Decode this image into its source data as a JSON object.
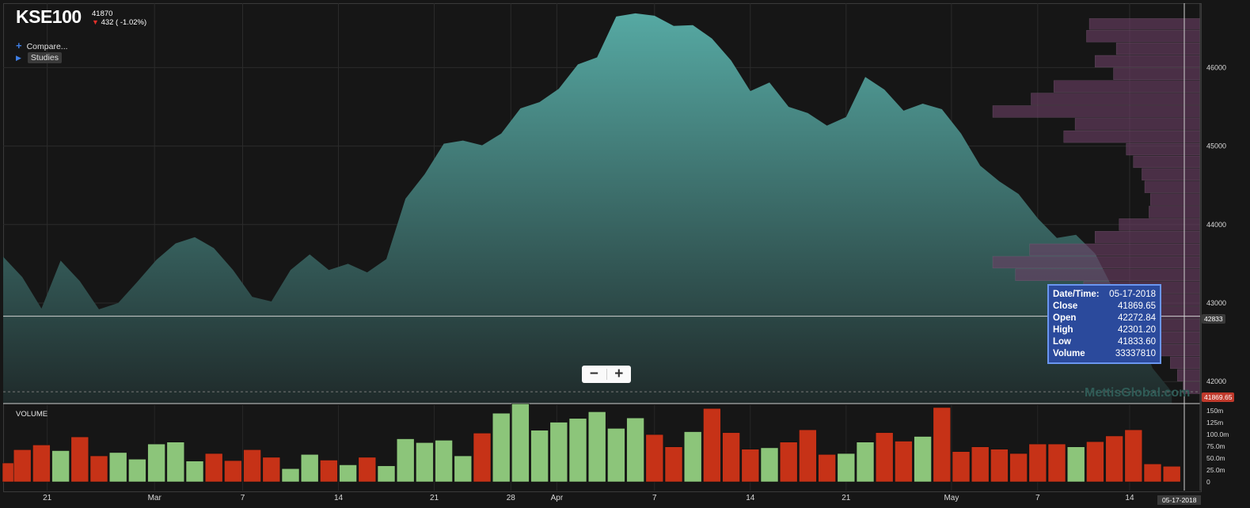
{
  "header": {
    "symbol": "KSE100",
    "last_price": "41870",
    "change": "432 ( -1.02%)"
  },
  "controls": {
    "compare_label": "Compare...",
    "studies_label": "Studies",
    "zoom_out": "−",
    "zoom_in": "+"
  },
  "watermark": "MettisGlobal.com",
  "volume_panel_label": "VOLUME",
  "crosshair": {
    "price_label": "42833",
    "date_label": "05-17-2018"
  },
  "current_close_label": "41869.65",
  "tooltip": {
    "rows": [
      {
        "key": "Date/Time:",
        "value": "05-17-2018"
      },
      {
        "key": "Close",
        "value": "41869.65"
      },
      {
        "key": "Open",
        "value": "42272.84"
      },
      {
        "key": "High",
        "value": "42301.20"
      },
      {
        "key": "Low",
        "value": "41833.60"
      },
      {
        "key": "Volume",
        "value": "33337810"
      }
    ]
  },
  "colors": {
    "area_top": "#56a9a3",
    "area_bottom": "#1f2a2a",
    "volume_up": "#8cc57a",
    "volume_down": "#c63217",
    "profile": "#6b3f64"
  },
  "chart_data": {
    "type": "area",
    "series": [
      {
        "name": "KSE100",
        "values": [
          43590,
          43330,
          42930,
          43540,
          43280,
          42920,
          43000,
          43270,
          43550,
          43760,
          43840,
          43700,
          43420,
          43080,
          43020,
          43420,
          43620,
          43420,
          43500,
          43390,
          43560,
          44330,
          44640,
          45030,
          45070,
          45010,
          45160,
          45480,
          45560,
          45730,
          46040,
          46130,
          46650,
          46690,
          46660,
          46530,
          46540,
          46370,
          46090,
          45700,
          45810,
          45500,
          45420,
          45260,
          45370,
          45880,
          45720,
          45450,
          45540,
          45470,
          45160,
          44750,
          44550,
          44390,
          44080,
          43830,
          43870,
          43630,
          43150,
          42790,
          42170,
          41870
        ]
      }
    ],
    "x_axis_labels": [
      "21",
      "Mar",
      "7",
      "14",
      "21",
      "28",
      "Apr",
      "7",
      "14",
      "21",
      "May",
      "7",
      "14"
    ],
    "y_axis": {
      "ticks": [
        42000,
        43000,
        44000,
        45000,
        46000
      ],
      "range": [
        41720,
        46780
      ]
    },
    "volume": {
      "values": [
        40,
        68,
        78,
        66,
        95,
        55,
        62,
        48,
        80,
        84,
        44,
        60,
        45,
        68,
        52,
        28,
        58,
        46,
        36,
        52,
        34,
        91,
        83,
        88,
        55,
        103,
        145,
        165,
        109,
        126,
        134,
        148,
        113,
        135,
        100,
        74,
        106,
        155,
        104,
        69,
        72,
        84,
        110,
        58,
        60,
        84,
        104,
        86,
        96,
        157,
        64,
        74,
        69,
        60,
        80,
        80,
        74,
        85,
        97,
        110,
        38,
        33
      ],
      "directions": [
        "d",
        "d",
        "d",
        "u",
        "d",
        "d",
        "u",
        "u",
        "u",
        "u",
        "u",
        "d",
        "d",
        "d",
        "d",
        "u",
        "u",
        "d",
        "u",
        "d",
        "u",
        "u",
        "u",
        "u",
        "u",
        "d",
        "u",
        "u",
        "u",
        "u",
        "u",
        "u",
        "u",
        "u",
        "d",
        "d",
        "u",
        "d",
        "d",
        "d",
        "u",
        "d",
        "d",
        "d",
        "u",
        "u",
        "d",
        "d",
        "u",
        "d",
        "d",
        "d",
        "d",
        "d",
        "d",
        "d",
        "u",
        "d",
        "d",
        "d",
        "d",
        "d"
      ],
      "y_ticks": [
        "0",
        "25.0m",
        "50.0m",
        "75.0m",
        "100.0m",
        "125m",
        "150m"
      ],
      "y_max": 162
    },
    "volume_profile": [
      {
        "price_from": 46480,
        "price_to": 46630,
        "size": 0.78
      },
      {
        "price_from": 46320,
        "price_to": 46480,
        "size": 0.8
      },
      {
        "price_from": 46160,
        "price_to": 46320,
        "size": 0.59
      },
      {
        "price_from": 46000,
        "price_to": 46160,
        "size": 0.74
      },
      {
        "price_from": 45840,
        "price_to": 46000,
        "size": 0.61
      },
      {
        "price_from": 45680,
        "price_to": 45840,
        "size": 1.03
      },
      {
        "price_from": 45520,
        "price_to": 45680,
        "size": 1.19
      },
      {
        "price_from": 45360,
        "price_to": 45520,
        "size": 1.46
      },
      {
        "price_from": 45200,
        "price_to": 45360,
        "size": 0.88
      },
      {
        "price_from": 45040,
        "price_to": 45200,
        "size": 0.96
      },
      {
        "price_from": 44880,
        "price_to": 45040,
        "size": 0.52
      },
      {
        "price_from": 44720,
        "price_to": 44880,
        "size": 0.47
      },
      {
        "price_from": 44560,
        "price_to": 44720,
        "size": 0.41
      },
      {
        "price_from": 44400,
        "price_to": 44560,
        "size": 0.39
      },
      {
        "price_from": 44240,
        "price_to": 44400,
        "size": 0.35
      },
      {
        "price_from": 44080,
        "price_to": 44240,
        "size": 0.36
      },
      {
        "price_from": 43920,
        "price_to": 44080,
        "size": 0.57
      },
      {
        "price_from": 43760,
        "price_to": 43920,
        "size": 0.74
      },
      {
        "price_from": 43600,
        "price_to": 43760,
        "size": 1.2
      },
      {
        "price_from": 43440,
        "price_to": 43600,
        "size": 1.46
      },
      {
        "price_from": 43280,
        "price_to": 43440,
        "size": 1.3
      },
      {
        "price_from": 43120,
        "price_to": 43280,
        "size": 0.82
      },
      {
        "price_from": 42960,
        "price_to": 43120,
        "size": 0.84
      },
      {
        "price_from": 42800,
        "price_to": 42960,
        "size": 0.61
      },
      {
        "price_from": 42640,
        "price_to": 42800,
        "size": 0.5
      },
      {
        "price_from": 42480,
        "price_to": 42640,
        "size": 0.35
      },
      {
        "price_from": 42320,
        "price_to": 42480,
        "size": 0.28
      },
      {
        "price_from": 42160,
        "price_to": 42320,
        "size": 0.21
      },
      {
        "price_from": 42000,
        "price_to": 42160,
        "size": 0.16
      },
      {
        "price_from": 41840,
        "price_to": 42000,
        "size": 0.12
      }
    ],
    "grid": true
  }
}
